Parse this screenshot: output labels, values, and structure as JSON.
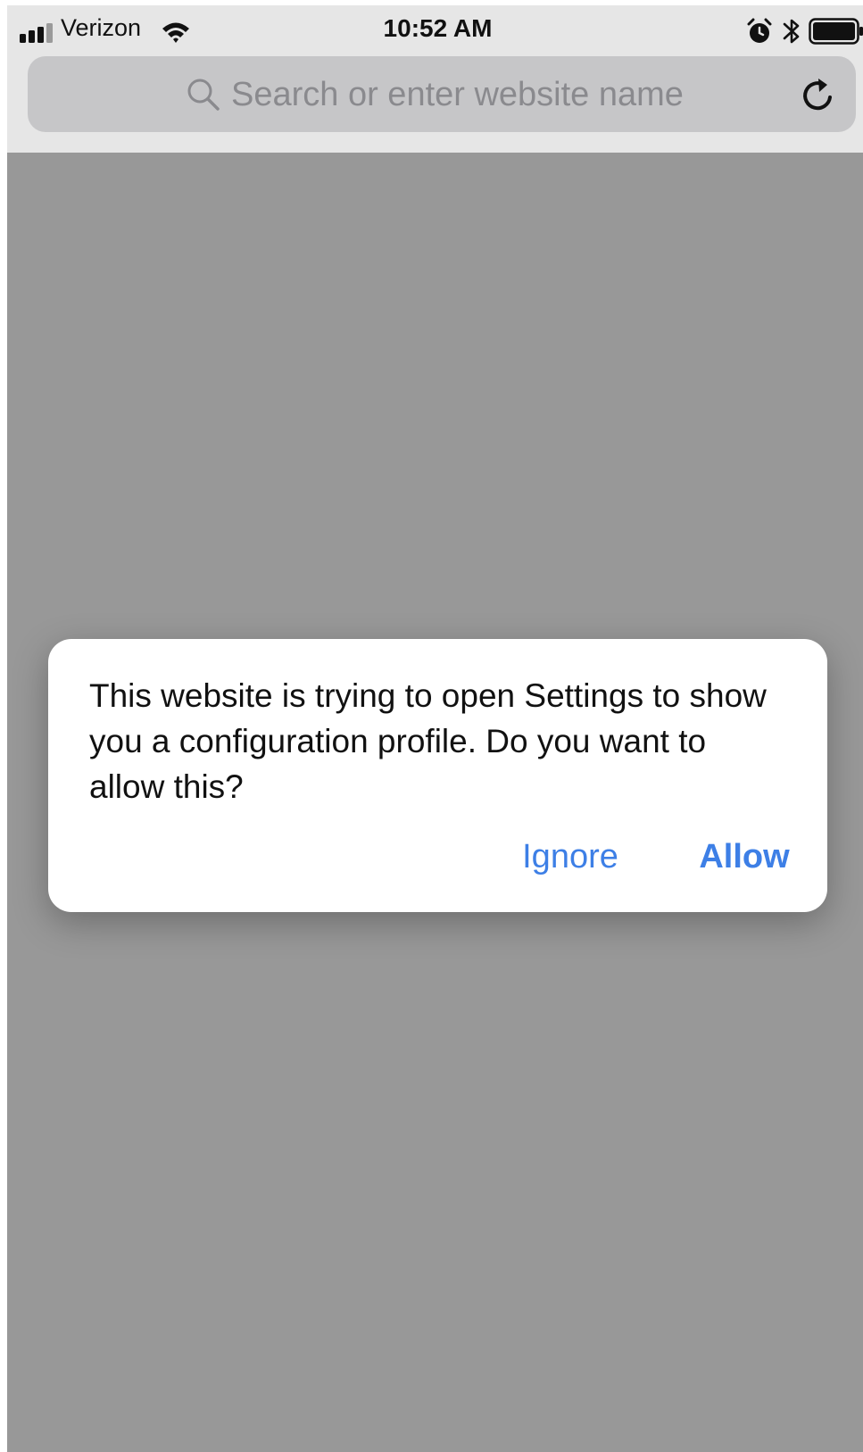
{
  "status_bar": {
    "carrier": "Verizon",
    "time": "10:52 AM",
    "icons": [
      "signal-icon",
      "wifi-icon",
      "alarm-icon",
      "bluetooth-icon",
      "battery-icon"
    ]
  },
  "address_bar": {
    "value": "",
    "placeholder": "Search or enter website name"
  },
  "dialog": {
    "message": "This website is trying to open Settings to show you a configuration profile. Do you want to allow this?",
    "ignore_label": "Ignore",
    "allow_label": "Allow"
  },
  "colors": {
    "accent": "#3d7fe6",
    "page_dim": "#989898",
    "toolbar": "#e6e6e6",
    "address_field": "#c6c6c8"
  }
}
